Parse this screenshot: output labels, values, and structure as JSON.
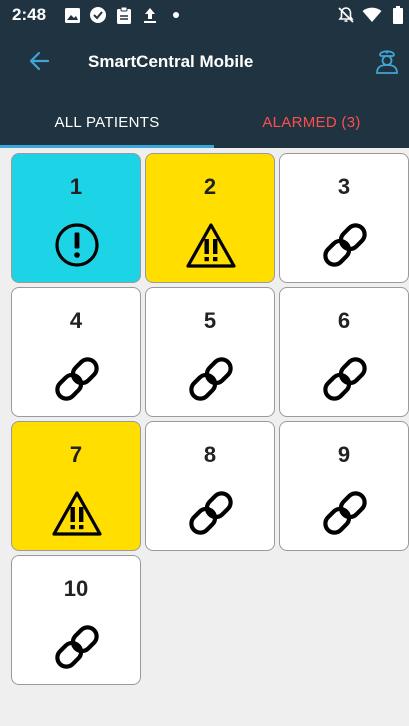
{
  "status_bar": {
    "time": "2:48",
    "left_icons": [
      "image-icon",
      "check-circle-icon",
      "clipboard-icon",
      "upload-icon",
      "dot-icon"
    ],
    "right_icons": [
      "notifications-off-icon",
      "wifi-icon",
      "battery-icon"
    ]
  },
  "app_bar": {
    "title": "SmartCentral Mobile",
    "back_icon": "arrow-back-icon",
    "user_icon": "nurse-icon"
  },
  "tabs": [
    {
      "label": "ALL PATIENTS",
      "selected": true
    },
    {
      "label": "ALARMED (3)",
      "selected": false
    }
  ],
  "colors": {
    "header_bg": "#1f3440",
    "tab_indicator": "#3aa6d9",
    "alarm_text": "#ff4d4d",
    "alert_cyan": "#1dd3e6",
    "warning_yellow": "#ffde00",
    "normal_white": "#ffffff"
  },
  "patients": [
    {
      "number": "1",
      "status": "alert",
      "icon": "exclamation-circle-icon",
      "color": "#1dd3e6"
    },
    {
      "number": "2",
      "status": "warning",
      "icon": "warning-triangle-icon",
      "color": "#ffde00"
    },
    {
      "number": "3",
      "status": "connected",
      "icon": "link-icon",
      "color": "#ffffff"
    },
    {
      "number": "4",
      "status": "connected",
      "icon": "link-icon",
      "color": "#ffffff"
    },
    {
      "number": "5",
      "status": "connected",
      "icon": "link-icon",
      "color": "#ffffff"
    },
    {
      "number": "6",
      "status": "connected",
      "icon": "link-icon",
      "color": "#ffffff"
    },
    {
      "number": "7",
      "status": "warning",
      "icon": "warning-triangle-icon",
      "color": "#ffde00"
    },
    {
      "number": "8",
      "status": "connected",
      "icon": "link-icon",
      "color": "#ffffff"
    },
    {
      "number": "9",
      "status": "connected",
      "icon": "link-icon",
      "color": "#ffffff"
    },
    {
      "number": "10",
      "status": "connected",
      "icon": "link-icon",
      "color": "#ffffff"
    }
  ]
}
